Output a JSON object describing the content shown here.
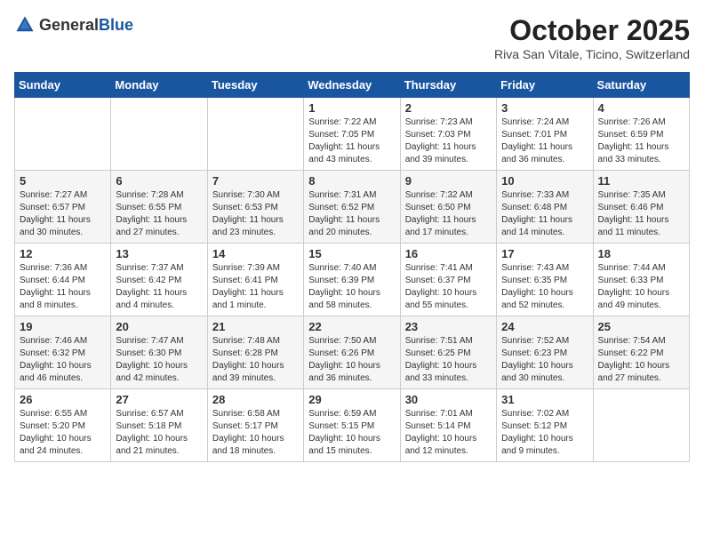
{
  "header": {
    "logo_general": "General",
    "logo_blue": "Blue",
    "month_title": "October 2025",
    "location": "Riva San Vitale, Ticino, Switzerland"
  },
  "weekdays": [
    "Sunday",
    "Monday",
    "Tuesday",
    "Wednesday",
    "Thursday",
    "Friday",
    "Saturday"
  ],
  "weeks": [
    [
      {
        "day": "",
        "info": ""
      },
      {
        "day": "",
        "info": ""
      },
      {
        "day": "",
        "info": ""
      },
      {
        "day": "1",
        "info": "Sunrise: 7:22 AM\nSunset: 7:05 PM\nDaylight: 11 hours and 43 minutes."
      },
      {
        "day": "2",
        "info": "Sunrise: 7:23 AM\nSunset: 7:03 PM\nDaylight: 11 hours and 39 minutes."
      },
      {
        "day": "3",
        "info": "Sunrise: 7:24 AM\nSunset: 7:01 PM\nDaylight: 11 hours and 36 minutes."
      },
      {
        "day": "4",
        "info": "Sunrise: 7:26 AM\nSunset: 6:59 PM\nDaylight: 11 hours and 33 minutes."
      }
    ],
    [
      {
        "day": "5",
        "info": "Sunrise: 7:27 AM\nSunset: 6:57 PM\nDaylight: 11 hours and 30 minutes."
      },
      {
        "day": "6",
        "info": "Sunrise: 7:28 AM\nSunset: 6:55 PM\nDaylight: 11 hours and 27 minutes."
      },
      {
        "day": "7",
        "info": "Sunrise: 7:30 AM\nSunset: 6:53 PM\nDaylight: 11 hours and 23 minutes."
      },
      {
        "day": "8",
        "info": "Sunrise: 7:31 AM\nSunset: 6:52 PM\nDaylight: 11 hours and 20 minutes."
      },
      {
        "day": "9",
        "info": "Sunrise: 7:32 AM\nSunset: 6:50 PM\nDaylight: 11 hours and 17 minutes."
      },
      {
        "day": "10",
        "info": "Sunrise: 7:33 AM\nSunset: 6:48 PM\nDaylight: 11 hours and 14 minutes."
      },
      {
        "day": "11",
        "info": "Sunrise: 7:35 AM\nSunset: 6:46 PM\nDaylight: 11 hours and 11 minutes."
      }
    ],
    [
      {
        "day": "12",
        "info": "Sunrise: 7:36 AM\nSunset: 6:44 PM\nDaylight: 11 hours and 8 minutes."
      },
      {
        "day": "13",
        "info": "Sunrise: 7:37 AM\nSunset: 6:42 PM\nDaylight: 11 hours and 4 minutes."
      },
      {
        "day": "14",
        "info": "Sunrise: 7:39 AM\nSunset: 6:41 PM\nDaylight: 11 hours and 1 minute."
      },
      {
        "day": "15",
        "info": "Sunrise: 7:40 AM\nSunset: 6:39 PM\nDaylight: 10 hours and 58 minutes."
      },
      {
        "day": "16",
        "info": "Sunrise: 7:41 AM\nSunset: 6:37 PM\nDaylight: 10 hours and 55 minutes."
      },
      {
        "day": "17",
        "info": "Sunrise: 7:43 AM\nSunset: 6:35 PM\nDaylight: 10 hours and 52 minutes."
      },
      {
        "day": "18",
        "info": "Sunrise: 7:44 AM\nSunset: 6:33 PM\nDaylight: 10 hours and 49 minutes."
      }
    ],
    [
      {
        "day": "19",
        "info": "Sunrise: 7:46 AM\nSunset: 6:32 PM\nDaylight: 10 hours and 46 minutes."
      },
      {
        "day": "20",
        "info": "Sunrise: 7:47 AM\nSunset: 6:30 PM\nDaylight: 10 hours and 42 minutes."
      },
      {
        "day": "21",
        "info": "Sunrise: 7:48 AM\nSunset: 6:28 PM\nDaylight: 10 hours and 39 minutes."
      },
      {
        "day": "22",
        "info": "Sunrise: 7:50 AM\nSunset: 6:26 PM\nDaylight: 10 hours and 36 minutes."
      },
      {
        "day": "23",
        "info": "Sunrise: 7:51 AM\nSunset: 6:25 PM\nDaylight: 10 hours and 33 minutes."
      },
      {
        "day": "24",
        "info": "Sunrise: 7:52 AM\nSunset: 6:23 PM\nDaylight: 10 hours and 30 minutes."
      },
      {
        "day": "25",
        "info": "Sunrise: 7:54 AM\nSunset: 6:22 PM\nDaylight: 10 hours and 27 minutes."
      }
    ],
    [
      {
        "day": "26",
        "info": "Sunrise: 6:55 AM\nSunset: 5:20 PM\nDaylight: 10 hours and 24 minutes."
      },
      {
        "day": "27",
        "info": "Sunrise: 6:57 AM\nSunset: 5:18 PM\nDaylight: 10 hours and 21 minutes."
      },
      {
        "day": "28",
        "info": "Sunrise: 6:58 AM\nSunset: 5:17 PM\nDaylight: 10 hours and 18 minutes."
      },
      {
        "day": "29",
        "info": "Sunrise: 6:59 AM\nSunset: 5:15 PM\nDaylight: 10 hours and 15 minutes."
      },
      {
        "day": "30",
        "info": "Sunrise: 7:01 AM\nSunset: 5:14 PM\nDaylight: 10 hours and 12 minutes."
      },
      {
        "day": "31",
        "info": "Sunrise: 7:02 AM\nSunset: 5:12 PM\nDaylight: 10 hours and 9 minutes."
      },
      {
        "day": "",
        "info": ""
      }
    ]
  ]
}
